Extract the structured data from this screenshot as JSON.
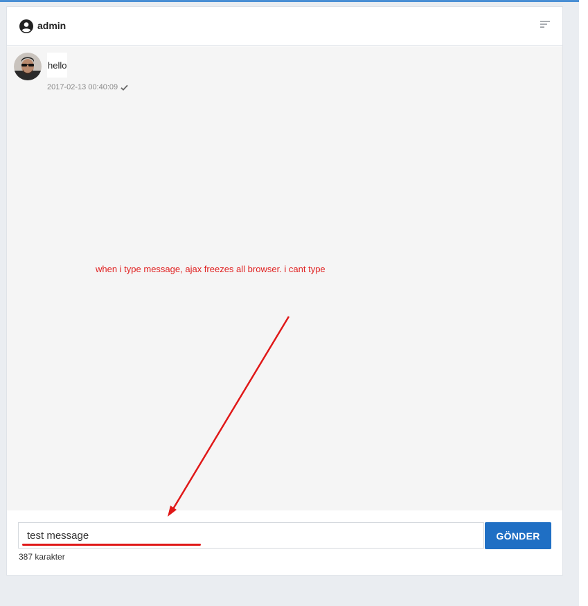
{
  "header": {
    "title": "admin",
    "user_icon": "user-circle-icon",
    "menu_icon": "sort-lines-icon"
  },
  "messages": [
    {
      "text": "hello",
      "timestamp": "2017-02-13 00:40:09",
      "status_icon": "check-icon"
    }
  ],
  "annotation": {
    "text": "when i type message, ajax freezes all browser. i cant type",
    "color": "#e02020"
  },
  "composer": {
    "input_value": "test message",
    "send_label": "GÖNDER",
    "char_count": "387 karakter"
  },
  "colors": {
    "accent": "#1f6fc4",
    "annotation": "#e02020",
    "background": "#eaedf1"
  }
}
